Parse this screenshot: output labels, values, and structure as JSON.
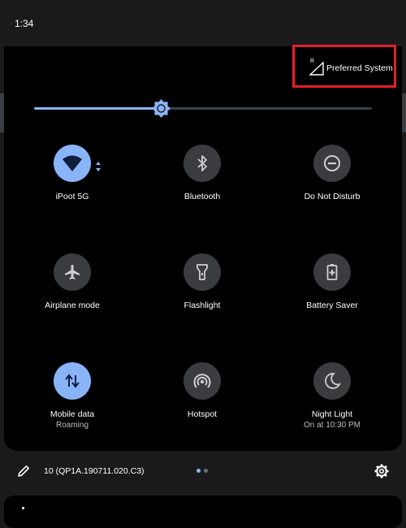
{
  "status_bar": {
    "time": "1:34"
  },
  "network": {
    "signal_prefix": "R",
    "label": "Preferred System",
    "highlight_color": "#e0202a"
  },
  "brightness": {
    "level": 0.38,
    "accent_color": "#8ab4f8"
  },
  "tiles": [
    {
      "id": "wifi",
      "label": "iPoot 5G",
      "sublabel": "",
      "icon": "wifi-icon",
      "active": true
    },
    {
      "id": "bluetooth",
      "label": "Bluetooth",
      "sublabel": "",
      "icon": "bluetooth-icon",
      "active": false
    },
    {
      "id": "dnd",
      "label": "Do Not Disturb",
      "sublabel": "",
      "icon": "do-not-disturb-icon",
      "active": false
    },
    {
      "id": "airplane",
      "label": "Airplane mode",
      "sublabel": "",
      "icon": "airplane-icon",
      "active": false
    },
    {
      "id": "flashlight",
      "label": "Flashlight",
      "sublabel": "",
      "icon": "flashlight-icon",
      "active": false
    },
    {
      "id": "battery-saver",
      "label": "Battery Saver",
      "sublabel": "",
      "icon": "battery-saver-icon",
      "active": false
    },
    {
      "id": "mobile-data",
      "label": "Mobile data",
      "sublabel": "Roaming",
      "icon": "mobile-data-icon",
      "active": true
    },
    {
      "id": "hotspot",
      "label": "Hotspot",
      "sublabel": "",
      "icon": "hotspot-icon",
      "active": false
    },
    {
      "id": "night-light",
      "label": "Night Light",
      "sublabel": "On at 10:30 PM",
      "icon": "night-light-icon",
      "active": false
    }
  ],
  "footer": {
    "build": "10 (QP1A.190711.020.C3)",
    "page_count": 2,
    "current_page": 1,
    "edit_icon": "pencil-icon",
    "settings_icon": "gear-icon"
  }
}
